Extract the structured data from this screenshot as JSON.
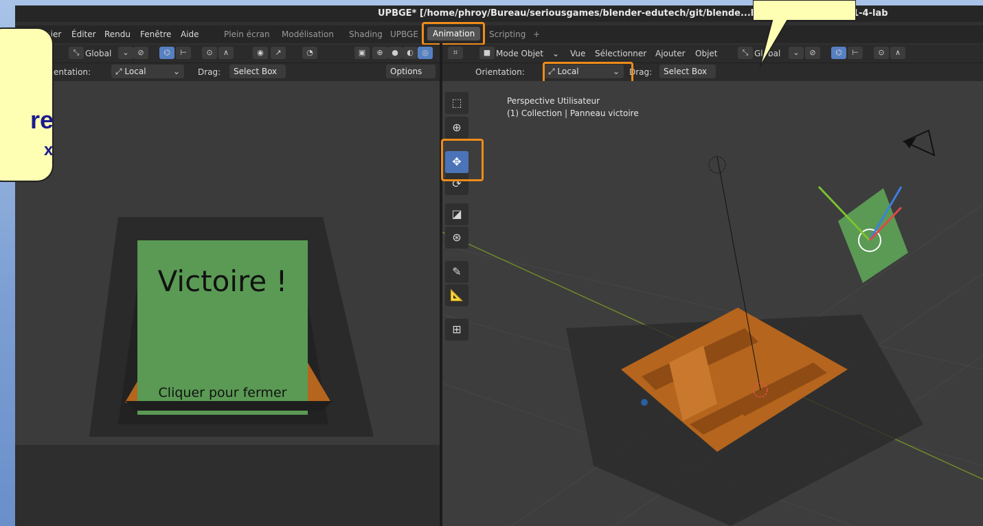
{
  "window": {
    "title": "UPBGE* [/home/phroy/Bureau/seriousgames/blender-edutech/git/blende...byrinthe/1-scene3D/1-4-lab"
  },
  "menu": {
    "items": [
      "hier",
      "Éditer",
      "Rendu",
      "Fenêtre",
      "Aide"
    ],
    "workspaces": [
      "Plein écran",
      "Modélisation",
      "Shading",
      "UPBGE",
      "Animation",
      "Scripting",
      "+"
    ],
    "active_workspace": "Animation"
  },
  "left_header": {
    "transform_space": "Global",
    "orientation_label": "entation:",
    "orientation_value": "Local",
    "drag_label": "Drag:",
    "drag_value": "Select Box",
    "options": "Options"
  },
  "right_header": {
    "mode": "Mode Objet",
    "menus": [
      "Vue",
      "Sélectionner",
      "Ajouter",
      "Objet"
    ],
    "transform_space": "Global",
    "orientation_label": "Orientation:",
    "orientation_value": "Local",
    "drag_label": "Drag:",
    "drag_value": "Select Box"
  },
  "viewport": {
    "view_name": "Perspective Utilisateur",
    "collection_info": "(1) Collection | Panneau victoire"
  },
  "panel": {
    "title": "Victoire !",
    "subtitle": "Cliquer pour fermer"
  },
  "callout": {
    "text": "re",
    "letter": "x"
  },
  "colors": {
    "highlight": "#ef8c1a",
    "panel_green": "#5a9a54",
    "maze_orange": "#b5651d",
    "callout_bg": "#ffffb3",
    "callout_text": "#1b1b8e"
  }
}
